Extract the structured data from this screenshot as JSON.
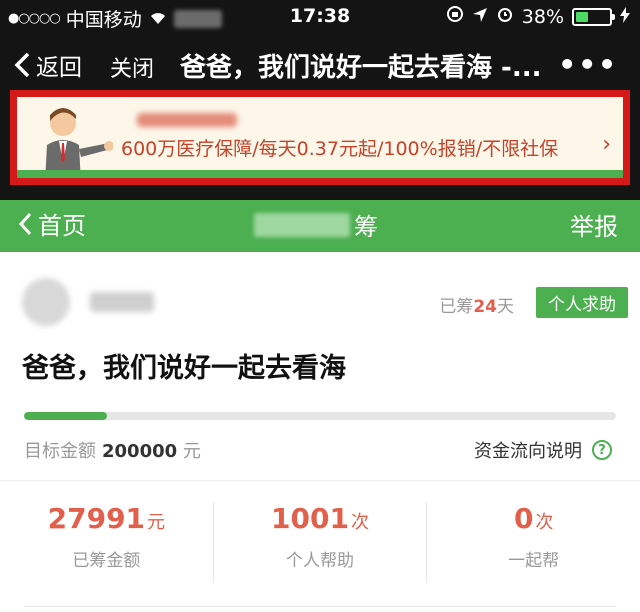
{
  "status_bar": {
    "carrier": "中国移动",
    "time": "17:38",
    "battery": "38%"
  },
  "nav": {
    "back_label": "返回",
    "close_label": "关闭",
    "title": "爸爸，我们说好一起去看海 -...",
    "more": "•••"
  },
  "ad": {
    "text": "600万医疗保障/每天0.37元起/100%报销/不限社保",
    "chevron": "›"
  },
  "header": {
    "back_label": "首页",
    "title_suffix": "筹",
    "report_label": "举报"
  },
  "campaign": {
    "raised_prefix": "已筹",
    "raised_days": "24",
    "raised_suffix": "天",
    "tag": "个人求助",
    "title": "爸爸，我们说好一起去看海",
    "progress": 0.14,
    "target_label": "目标金额",
    "target_amount": "200000",
    "target_unit": "元",
    "funds_label": "资金流向说明",
    "funds_icon": "?"
  },
  "stats": [
    {
      "value": "27991",
      "unit": "元",
      "label": "已筹金额",
      "color": "#e2604b"
    },
    {
      "value": "1001",
      "unit": "次",
      "label": "个人帮助",
      "color": "#e2604b"
    },
    {
      "value": "0",
      "unit": "次",
      "label": "一起帮",
      "color": "#e2604b"
    }
  ],
  "colors": {
    "green": "#4caf50",
    "highlight_border": "#d51818",
    "accent": "#e2604b"
  }
}
